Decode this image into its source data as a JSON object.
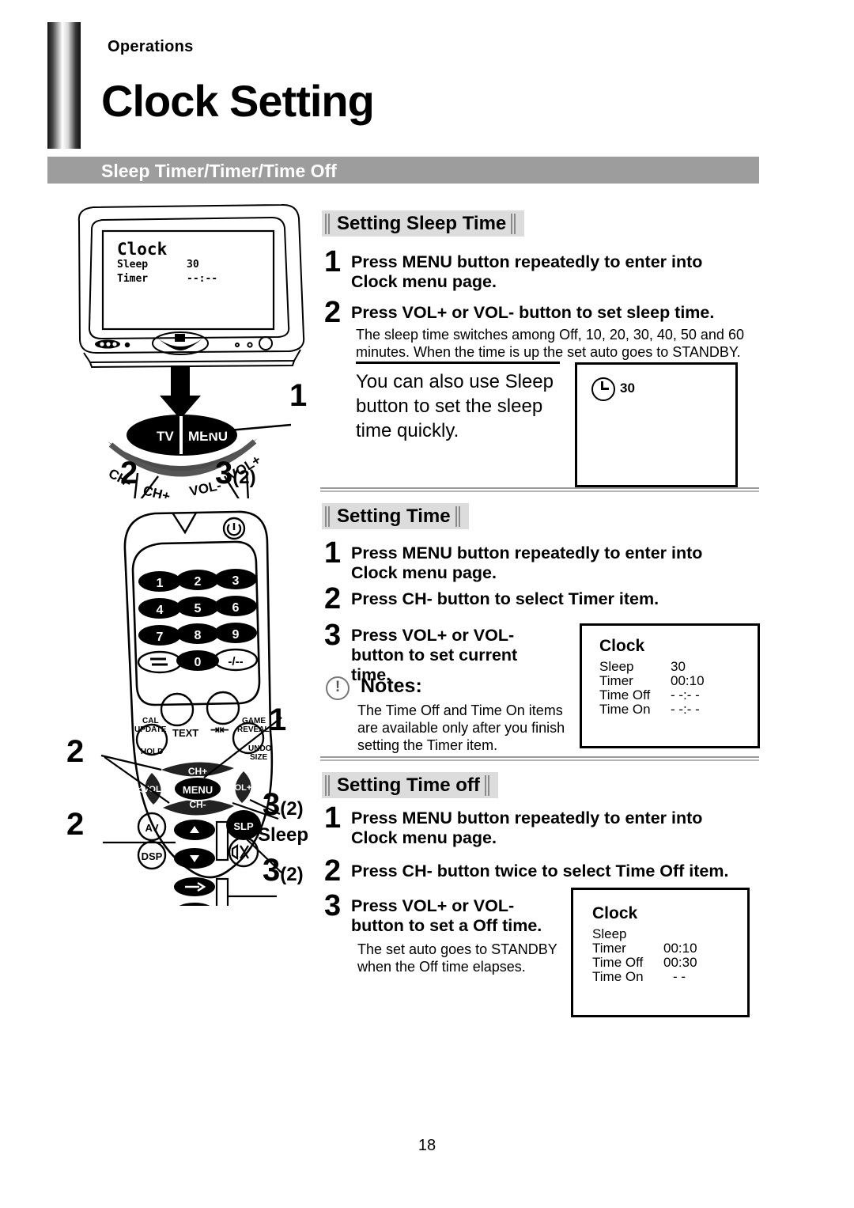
{
  "header": {
    "kicker": "Operations",
    "title": "Clock Setting",
    "topic_bar": "Sleep Timer/Timer/Time Off",
    "topic_bar_color": "#9d9d9d"
  },
  "tv_screen_osd": {
    "title": "Clock",
    "rows": [
      {
        "label": "Sleep",
        "value": "30"
      },
      {
        "label": "Timer",
        "value": "--:--"
      }
    ]
  },
  "tv_controls": {
    "buttons": [
      "TV",
      "MENU",
      "CH-",
      "CH+",
      "VOL-",
      "VOL+"
    ],
    "callouts": [
      {
        "num": "1",
        "paren": ""
      },
      {
        "num": "2",
        "paren": ""
      },
      {
        "num": "3",
        "paren": "(2)"
      }
    ]
  },
  "remote": {
    "keypad": [
      "1",
      "2",
      "3",
      "4",
      "5",
      "6",
      "7",
      "8",
      "9",
      "0"
    ],
    "keypad_extra": [
      "⇄",
      "-/--"
    ],
    "fn_labels": [
      "CAL",
      "UPDATE",
      "TEXT",
      "GAME",
      "REVEAL",
      "HOLD",
      "UNDO",
      "SIZE"
    ],
    "nav": [
      "CH+",
      "CH-",
      "VOL-",
      "VOL+",
      "MENU"
    ],
    "side_buttons": [
      "AV",
      "DSP",
      "SLP"
    ],
    "callouts": [
      {
        "num": "1",
        "paren": ""
      },
      {
        "num": "2",
        "paren": ""
      },
      {
        "num": "3",
        "paren": "(2)"
      },
      {
        "num": "2",
        "paren": ""
      },
      {
        "num": "3",
        "paren": "(2)"
      }
    ],
    "sleep_label": "Sleep"
  },
  "sections": [
    {
      "heading": "Setting Sleep Time",
      "steps": [
        {
          "num": "1",
          "text": "Press MENU button repeatedly to enter into Clock menu page."
        },
        {
          "num": "2",
          "text": "Press VOL+ or VOL- button to set sleep time."
        }
      ],
      "note_text": "The sleep time switches among Off, 10, 20, 30, 40, 50 and 60 minutes. When the time is up the set auto goes to STANDBY.",
      "tip_text": "You can also use Sleep button to set the sleep time quickly.",
      "osd": {
        "icon": "clock-icon",
        "value": "30"
      }
    },
    {
      "heading": "Setting Time",
      "steps": [
        {
          "num": "1",
          "text": "Press MENU button repeatedly to enter into Clock menu page."
        },
        {
          "num": "2",
          "text": "Press CH- button to select Timer item."
        },
        {
          "num": "3",
          "text": "Press VOL+ or VOL- button to set current time."
        }
      ],
      "notes_title": "Notes:",
      "notes_text": "The Time Off and Time On items are available only after you finish setting the Timer item.",
      "osd": {
        "title": "Clock",
        "rows": [
          {
            "label": "Sleep",
            "value": "30"
          },
          {
            "label": "Timer",
            "value": "00:10"
          },
          {
            "label": "Time Off",
            "value": "- -:- -"
          },
          {
            "label": "Time On",
            "value": "- -:- -"
          }
        ]
      }
    },
    {
      "heading": "Setting Time off",
      "steps": [
        {
          "num": "1",
          "text": "Press MENU button repeatedly to enter into Clock menu page."
        },
        {
          "num": "2",
          "text": "Press CH- button twice to select Time Off item."
        },
        {
          "num": "3",
          "text": "Press VOL+ or VOL- button to set a Off time."
        }
      ],
      "note_text": "The set auto goes to STANDBY when the Off time elapses.",
      "osd": {
        "title": "Clock",
        "rows": [
          {
            "label": "Sleep",
            "value": ""
          },
          {
            "label": "Timer",
            "value": "00:10"
          },
          {
            "label": "Time Off",
            "value": "00:30"
          },
          {
            "label": "Time On",
            "value": "- -"
          }
        ]
      }
    }
  ],
  "footer": {
    "page_number": "18"
  }
}
